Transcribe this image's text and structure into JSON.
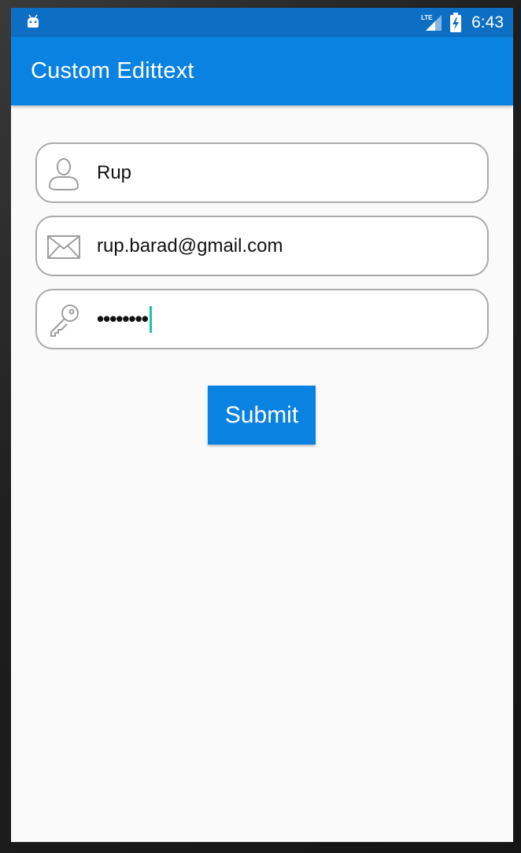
{
  "status_bar": {
    "network_label": "LTE",
    "time": "6:43",
    "icons": [
      "android-debug-icon",
      "lte-signal-icon",
      "battery-charging-icon"
    ]
  },
  "app_bar": {
    "title": "Custom Edittext"
  },
  "form": {
    "name_field": {
      "value": "Rup",
      "icon": "person-icon"
    },
    "email_field": {
      "value": "rup.barad@gmail.com",
      "icon": "envelope-icon"
    },
    "password_field": {
      "value": "••••••••",
      "icon": "key-icon",
      "focused": true
    },
    "submit_label": "Submit"
  },
  "colors": {
    "status_bar": "#0d6fc4",
    "app_bar": "#0a82e2",
    "accent": "#0a82e2",
    "cursor": "#1bc6a6",
    "field_border": "#aaaaaa",
    "background": "#fafafa"
  }
}
